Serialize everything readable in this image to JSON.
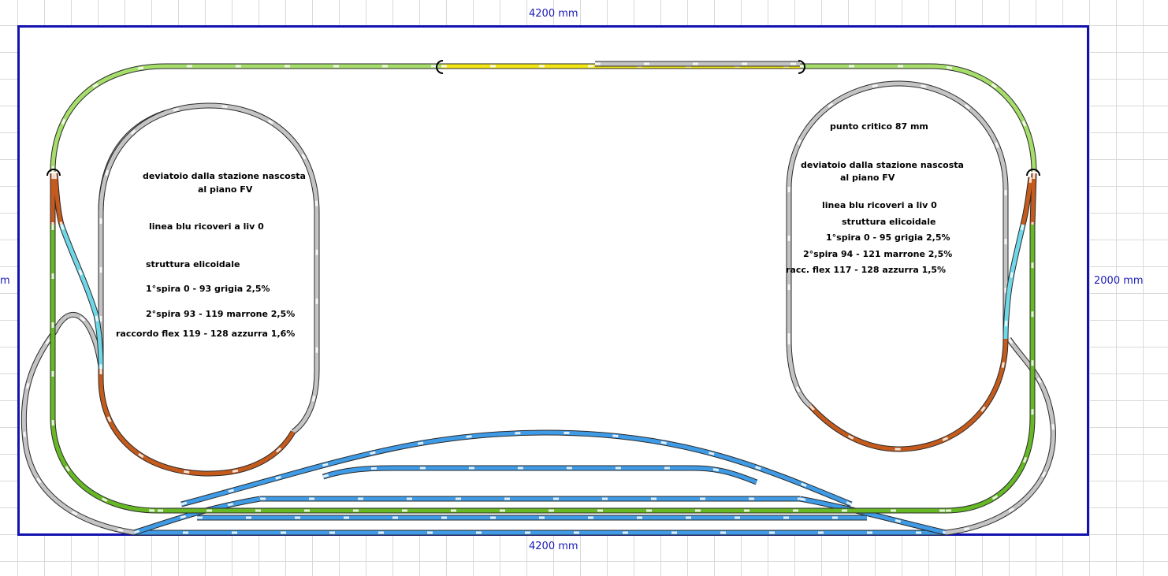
{
  "dimensions": {
    "top_width": "4200 mm",
    "bottom_width": "4200 mm",
    "right_height": "2000 mm",
    "left_height_fragment": "m"
  },
  "left_notes": {
    "turnout_line1": "deviatoio dalla stazione nascosta",
    "turnout_line2": "al piano FV",
    "blue_line": "linea blu ricoveri a liv 0",
    "structure": "struttura elicoidale",
    "spiral1": "1°spira 0 - 93 grigia 2,5%",
    "spiral2": "2°spira 93 - 119 marrone 2,5%",
    "flex": "raccordo flex  119 - 128 azzurra 1,6%"
  },
  "right_notes": {
    "critical": "punto critico 87 mm",
    "turnout_line1": "deviatoio dalla stazione nascosta",
    "turnout_line2": "al piano FV",
    "blue_line": "linea blu ricoveri a liv 0",
    "structure": "struttura elicoidale",
    "spiral1": "1°spira 0 - 95 grigia 2,5%",
    "spiral2": "2°spira 94 - 121 marrone 2,5%",
    "flex": "racc. flex  117 - 128 azzurra 1,5%"
  },
  "colors": {
    "frame": "#1212b0",
    "dimension_text": "#1a1ab8",
    "grid": "#d9d9d9",
    "track_light_green": "#a6de6a",
    "track_green": "#66b824",
    "track_gray": "#c4c4c4",
    "track_brown": "#c45a1c",
    "track_blue": "#3f9be6",
    "track_cyan": "#6fd8e8",
    "track_yellow": "#f2e614"
  }
}
